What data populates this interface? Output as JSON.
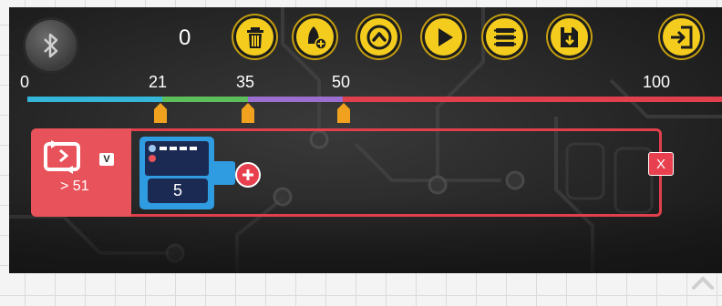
{
  "toolbar": {
    "counter": "0",
    "buttons": [
      {
        "name": "delete",
        "icon": "trash-icon"
      },
      {
        "name": "add-block",
        "icon": "add-block-icon"
      },
      {
        "name": "up",
        "icon": "chevron-up-icon"
      },
      {
        "name": "play",
        "icon": "play-icon"
      },
      {
        "name": "blocks",
        "icon": "stacked-blocks-icon"
      },
      {
        "name": "save",
        "icon": "save-icon"
      },
      {
        "name": "exit",
        "icon": "exit-door-icon"
      }
    ],
    "bluetooth_icon": "bluetooth-icon"
  },
  "timeline": {
    "ticks": [
      "0",
      "21",
      "35",
      "50",
      "100"
    ],
    "segment_colors": [
      "#35b5d8",
      "#5cbf5c",
      "#9b6fcf",
      "#e0404c"
    ]
  },
  "block": {
    "badge": "V",
    "condition": "> 51",
    "sensor_value": "5",
    "close_label": "X"
  },
  "colors": {
    "accent": "#f3cc1e",
    "loop": "#e8525a",
    "sensor": "#2f9be0",
    "danger": "#e8404e"
  }
}
